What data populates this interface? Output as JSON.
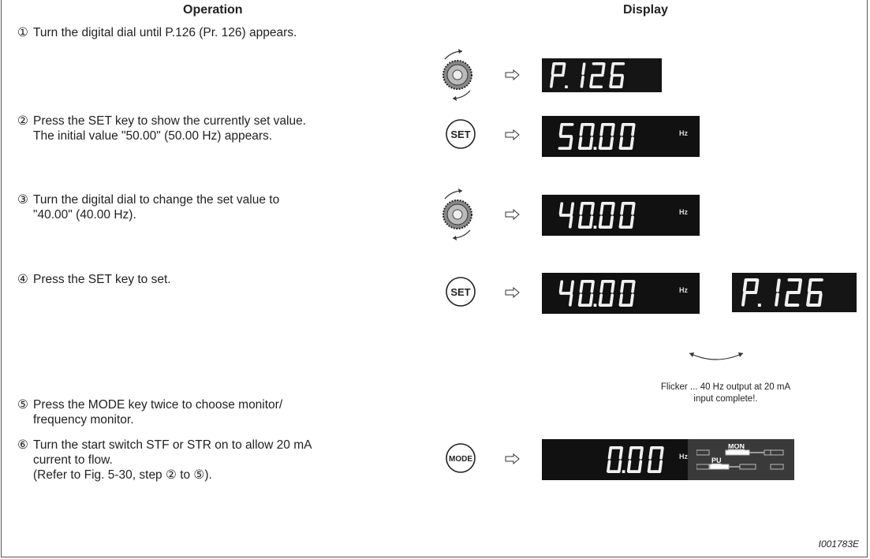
{
  "headers": {
    "operation": "Operation",
    "display": "Display"
  },
  "steps": [
    {
      "num": "①",
      "lines": [
        "Turn the digital dial until P.126 (Pr. 126) appears."
      ]
    },
    {
      "num": "②",
      "lines": [
        "Press the SET key to show the currently set value.",
        "The initial value \"50.00\" (50.00 Hz) appears."
      ]
    },
    {
      "num": "③",
      "lines": [
        "Turn the digital dial to change the set value to",
        "\"40.00\" (40.00 Hz)."
      ]
    },
    {
      "num": "④",
      "lines": [
        "Press the SET key to set."
      ]
    },
    {
      "num": "⑤",
      "lines": [
        "Press the MODE key twice to choose monitor/",
        "frequency monitor."
      ]
    },
    {
      "num": "⑥",
      "lines": [
        "Turn the start switch STF or STR on to allow 20 mA",
        "current to flow.",
        "(Refer to Fig. 5-30, step ② to ⑤)."
      ]
    }
  ],
  "keys": {
    "set": "SET",
    "mode": "MODE"
  },
  "displays": {
    "d1": "P.126",
    "d2": "50.00",
    "d3": "40.00",
    "d4": "40.00",
    "d4b": "P.126",
    "d6": "0.00"
  },
  "units": {
    "hz": "Hz",
    "mon": "MON",
    "pu": "PU"
  },
  "caption": {
    "line1": "Flicker ... 40 Hz output at 20 mA",
    "line2": "input complete!."
  },
  "figure_code": "I001783E",
  "icons": [
    "digital-dial-icon",
    "set-key-icon",
    "mode-key-icon",
    "right-arrow-icon",
    "flicker-arrow-icon"
  ]
}
